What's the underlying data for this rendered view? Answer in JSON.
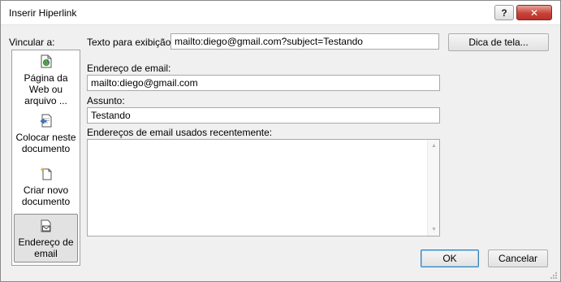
{
  "window": {
    "title": "Inserir Hiperlink",
    "help_glyph": "?",
    "close_glyph": "✕"
  },
  "sidebar": {
    "heading": "Vincular a:",
    "items": [
      {
        "label": "Página da Web ou arquivo ...",
        "icon": "web-page-icon",
        "selected": false
      },
      {
        "label": "Colocar neste documento",
        "icon": "place-in-document-icon",
        "selected": false
      },
      {
        "label": "Criar novo documento",
        "icon": "new-document-icon",
        "selected": false
      },
      {
        "label": "Endereço de email",
        "icon": "email-address-icon",
        "selected": true
      }
    ]
  },
  "display_text": {
    "label": "Texto para exibição:",
    "value": "mailto:diego@gmail.com?subject=Testando"
  },
  "screentip_button": "Dica de tela...",
  "email": {
    "label": "Endereço de email:",
    "value": "mailto:diego@gmail.com"
  },
  "subject": {
    "label": "Assunto:",
    "value": "Testando"
  },
  "recent": {
    "label": "Endereços de email usados recentemente:",
    "items": []
  },
  "buttons": {
    "ok": "OK",
    "cancel": "Cancelar"
  },
  "colors": {
    "dialog_bg": "#f0f0f0",
    "close_button": "#c7433a",
    "default_button_border": "#3c7fb1"
  }
}
